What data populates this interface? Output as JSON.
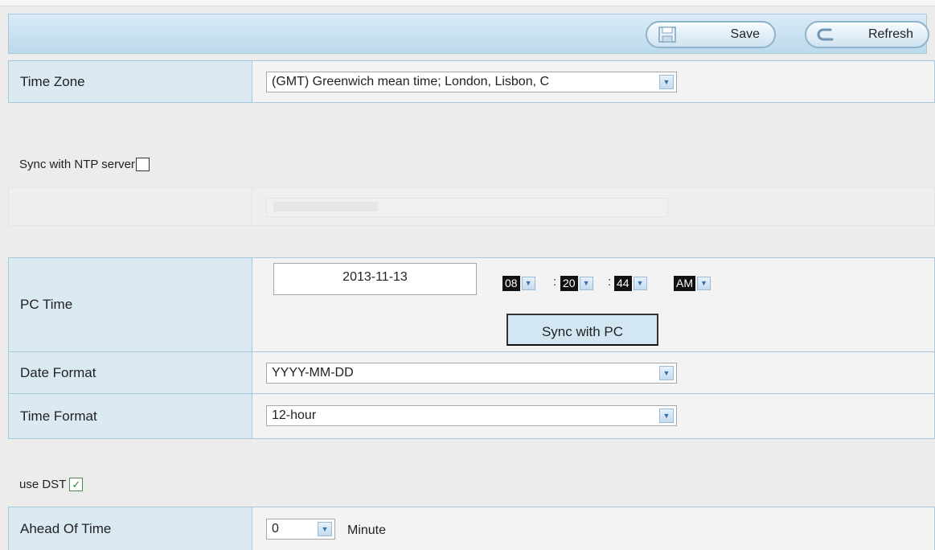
{
  "toolbar": {
    "save_label": "Save",
    "refresh_label": "Refresh"
  },
  "time_zone": {
    "label": "Time Zone",
    "value": "(GMT) Greenwich mean time; London, Lisbon, C"
  },
  "ntp": {
    "label": "Sync with NTP server",
    "checked": false
  },
  "pc_time": {
    "label": "PC Time",
    "date": "2013-11-13",
    "hour": "08",
    "minute": "20",
    "second": "44",
    "ampm": "AM",
    "colon": ":",
    "sync_label": "Sync with PC"
  },
  "date_format": {
    "label": "Date Format",
    "value": "YYYY-MM-DD"
  },
  "time_format": {
    "label": "Time Format",
    "value": "12-hour"
  },
  "dst": {
    "label": "use DST",
    "checked": true
  },
  "ahead_of_time": {
    "label": "Ahead Of Time",
    "value": "0",
    "unit": "Minute"
  },
  "icons": {
    "save": "floppy-disk-icon",
    "refresh": "refresh-arrow-icon",
    "dropdown": "chevron-down-icon",
    "check": "check-icon"
  },
  "colors": {
    "toolbar_bg": "#c9e0ef",
    "label_bg": "#dbe9f3",
    "border": "#a9c8dc",
    "page_bg": "#ececec"
  }
}
